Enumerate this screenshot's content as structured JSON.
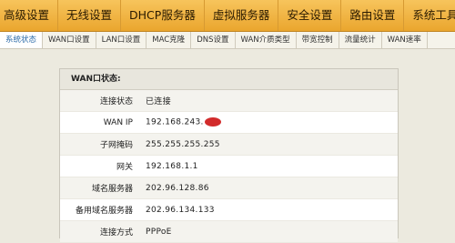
{
  "topnav": [
    {
      "label": "高级设置"
    },
    {
      "label": "无线设置"
    },
    {
      "label": "DHCP服务器"
    },
    {
      "label": "虚拟服务器"
    },
    {
      "label": "安全设置"
    },
    {
      "label": "路由设置"
    },
    {
      "label": "系统工具"
    }
  ],
  "subnav": [
    {
      "label": "系统状态",
      "active": true
    },
    {
      "label": "WAN口设置"
    },
    {
      "label": "LAN口设置"
    },
    {
      "label": "MAC克隆"
    },
    {
      "label": "DNS设置"
    },
    {
      "label": "WAN介质类型"
    },
    {
      "label": "带宽控制"
    },
    {
      "label": "流量统计"
    },
    {
      "label": "WAN速率"
    }
  ],
  "panel": {
    "title": "WAN口状态:",
    "rows": [
      {
        "label": "连接状态",
        "value": "已连接"
      },
      {
        "label": "WAN IP",
        "value": "192.168.243."
      },
      {
        "label": "子网掩码",
        "value": "255.255.255.255"
      },
      {
        "label": "网关",
        "value": "192.168.1.1"
      },
      {
        "label": "域名服务器",
        "value": "202.96.128.86"
      },
      {
        "label": "备用域名服务器",
        "value": "202.96.134.133"
      },
      {
        "label": "连接方式",
        "value": "PPPoE"
      }
    ]
  },
  "colors": {
    "nav": "#eaa62e",
    "redaction": "#d22b2b"
  }
}
